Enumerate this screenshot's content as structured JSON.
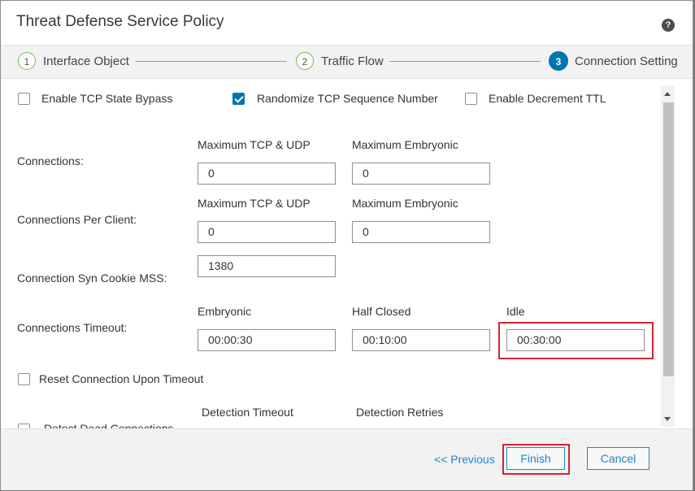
{
  "dialog": {
    "title": "Threat Defense Service Policy"
  },
  "steps": [
    {
      "number": "1",
      "label": "Interface Object"
    },
    {
      "number": "2",
      "label": "Traffic Flow"
    },
    {
      "number": "3",
      "label": "Connection Setting"
    }
  ],
  "options": {
    "tcp_state_bypass": {
      "label": "Enable TCP State Bypass",
      "checked": false
    },
    "randomize_tcp_seq": {
      "label": "Randomize TCP Sequence Number",
      "checked": true
    },
    "decrement_ttl": {
      "label": "Enable Decrement TTL",
      "checked": false
    }
  },
  "connections": {
    "label": "Connections:",
    "max_tcp_udp_label": "Maximum TCP & UDP",
    "max_embryonic_label": "Maximum Embryonic",
    "max_tcp_udp_value": "0",
    "max_embryonic_value": "0"
  },
  "connections_per_client": {
    "label": "Connections Per Client:",
    "max_tcp_udp_label": "Maximum TCP & UDP",
    "max_embryonic_label": "Maximum Embryonic",
    "max_tcp_udp_value": "0",
    "max_embryonic_value": "0"
  },
  "syn_cookie": {
    "label": "Connection Syn Cookie MSS:",
    "value": "1380"
  },
  "timeout": {
    "label": "Connections Timeout:",
    "embryonic_label": "Embryonic",
    "half_closed_label": "Half Closed",
    "idle_label": "Idle",
    "embryonic_value": "00:00:30",
    "half_closed_value": "00:10:00",
    "idle_value": "00:30:00"
  },
  "reset_on_timeout": {
    "label": "Reset Connection Upon Timeout",
    "checked": false
  },
  "dead_connection": {
    "detection_timeout_label": "Detection Timeout",
    "detection_retries_label": "Detection Retries",
    "label": "Detect Dead Connections"
  },
  "footer": {
    "previous_label": "<< Previous",
    "finish_label": "Finish",
    "cancel_label": "Cancel"
  },
  "colors": {
    "accent": "#0175b2",
    "step_line": "#6cc04a",
    "highlight": "#d9232e",
    "link": "#1e88c8"
  },
  "icons": {
    "help": "help-icon"
  }
}
